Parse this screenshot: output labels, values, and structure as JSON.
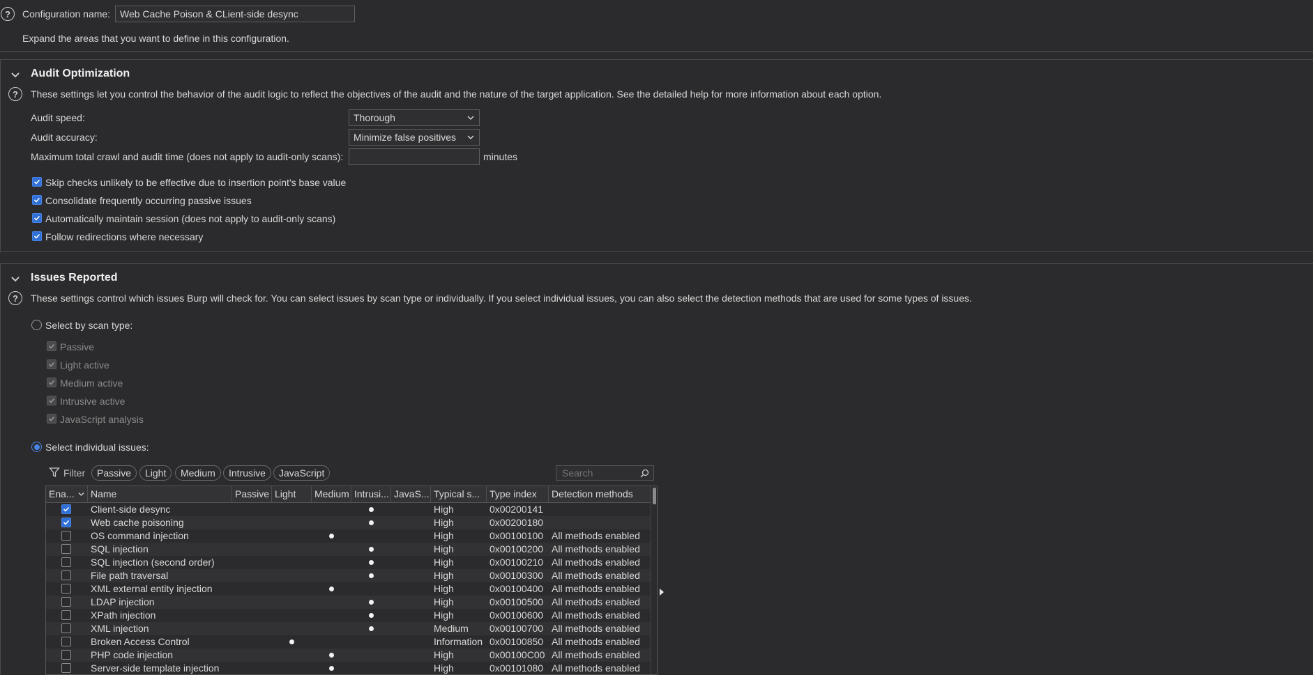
{
  "config": {
    "name_label": "Configuration name:",
    "name_value": "Web Cache Poison & CLient-side desync",
    "expand_hint": "Expand the areas that you want to define in this configuration."
  },
  "audit": {
    "title": "Audit Optimization",
    "description": "These settings let you control the behavior of the audit logic to reflect the objectives of the audit and the nature of the target application. See the detailed help for more information about each option.",
    "speed_label": "Audit speed:",
    "speed_value": "Thorough",
    "accuracy_label": "Audit accuracy:",
    "accuracy_value": "Minimize false positives",
    "maxtime_label": "Maximum total crawl and audit time (does not apply to audit-only scans):",
    "maxtime_value": "",
    "maxtime_unit": "minutes",
    "checks": [
      {
        "label": "Skip checks unlikely to be effective due to insertion point's base value",
        "checked": true
      },
      {
        "label": "Consolidate frequently occurring passive issues",
        "checked": true
      },
      {
        "label": "Automatically maintain session (does not apply to audit-only scans)",
        "checked": true
      },
      {
        "label": "Follow redirections where necessary",
        "checked": true
      }
    ]
  },
  "issues": {
    "title": "Issues Reported",
    "description": "These settings control which issues Burp will check for. You can select issues by scan type or individually. If you select individual issues, you can also select the detection methods that are used for some types of issues.",
    "by_scan_type_label": "Select by scan type:",
    "scan_types": [
      "Passive",
      "Light active",
      "Medium active",
      "Intrusive active",
      "JavaScript analysis"
    ],
    "individual_label": "Select individual issues:",
    "filter_label": "Filter",
    "filter_pills": [
      "Passive",
      "Light",
      "Medium",
      "Intrusive",
      "JavaScript"
    ],
    "search_placeholder": "Search",
    "columns": [
      "Ena...",
      "Name",
      "Passive",
      "Light",
      "Medium",
      "Intrusi...",
      "JavaS...",
      "Typical s...",
      "Type index",
      "Detection methods"
    ],
    "rows": [
      {
        "enabled": true,
        "name": "Client-side desync",
        "scan": "intrusive",
        "severity": "High",
        "type_index": "0x00200141",
        "detection": ""
      },
      {
        "enabled": true,
        "name": "Web cache poisoning",
        "scan": "intrusive",
        "severity": "High",
        "type_index": "0x00200180",
        "detection": ""
      },
      {
        "enabled": false,
        "name": "OS command injection",
        "scan": "medium",
        "severity": "High",
        "type_index": "0x00100100",
        "detection": "All methods enabled"
      },
      {
        "enabled": false,
        "name": "SQL injection",
        "scan": "intrusive",
        "severity": "High",
        "type_index": "0x00100200",
        "detection": "All methods enabled"
      },
      {
        "enabled": false,
        "name": "SQL injection (second order)",
        "scan": "intrusive",
        "severity": "High",
        "type_index": "0x00100210",
        "detection": "All methods enabled"
      },
      {
        "enabled": false,
        "name": "File path traversal",
        "scan": "intrusive",
        "severity": "High",
        "type_index": "0x00100300",
        "detection": "All methods enabled"
      },
      {
        "enabled": false,
        "name": "XML external entity injection",
        "scan": "medium",
        "severity": "High",
        "type_index": "0x00100400",
        "detection": "All methods enabled"
      },
      {
        "enabled": false,
        "name": "LDAP injection",
        "scan": "intrusive",
        "severity": "High",
        "type_index": "0x00100500",
        "detection": "All methods enabled"
      },
      {
        "enabled": false,
        "name": "XPath injection",
        "scan": "intrusive",
        "severity": "High",
        "type_index": "0x00100600",
        "detection": "All methods enabled"
      },
      {
        "enabled": false,
        "name": "XML injection",
        "scan": "intrusive",
        "severity": "Medium",
        "type_index": "0x00100700",
        "detection": "All methods enabled"
      },
      {
        "enabled": false,
        "name": "Broken Access Control",
        "scan": "light",
        "severity": "Information",
        "type_index": "0x00100850",
        "detection": "All methods enabled"
      },
      {
        "enabled": false,
        "name": "PHP code injection",
        "scan": "medium",
        "severity": "High",
        "type_index": "0x00100C00",
        "detection": "All methods enabled"
      },
      {
        "enabled": false,
        "name": "Server-side template injection",
        "scan": "medium",
        "severity": "High",
        "type_index": "0x00101080",
        "detection": "All methods enabled"
      }
    ]
  },
  "colors": {
    "accent": "#2f6fd6",
    "background": "#2b2b2d"
  }
}
